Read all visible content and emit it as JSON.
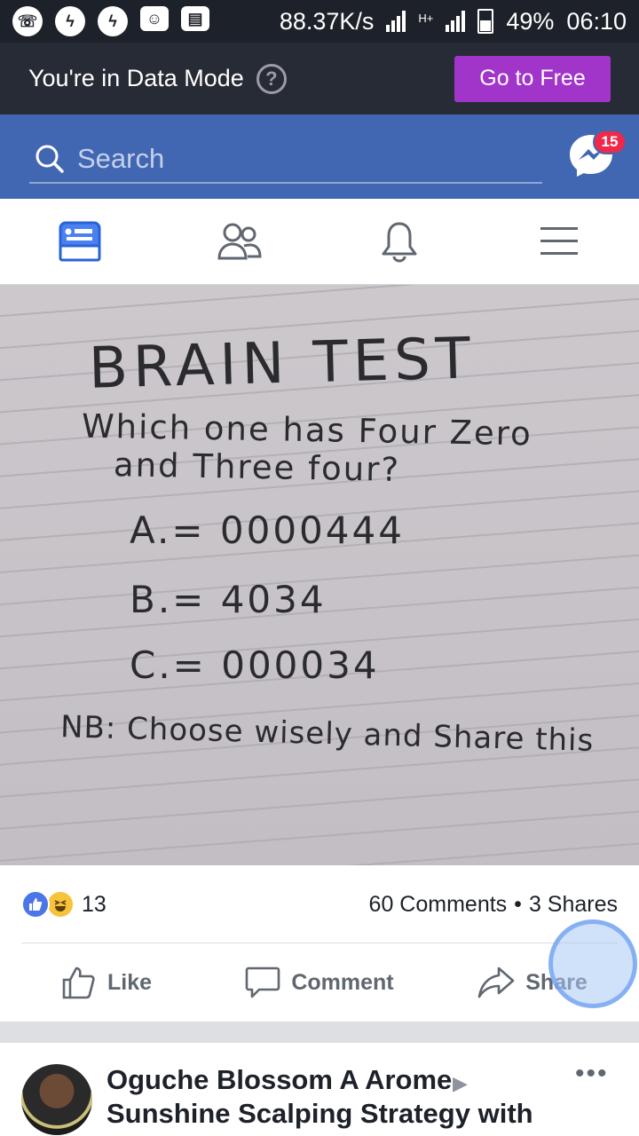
{
  "status_bar": {
    "apps": [
      "whatsapp-icon",
      "messenger-icon",
      "messenger-icon",
      "bbm-icon",
      "video-icon"
    ],
    "network_speed": "88.37K/s",
    "network_type": "H+",
    "battery": "49%",
    "time": "06:10"
  },
  "data_mode": {
    "text": "You're in Data Mode",
    "help": "?",
    "button": "Go to Free"
  },
  "search": {
    "placeholder": "Search",
    "messenger_badge": "15"
  },
  "nav_tabs": [
    "news-feed-icon",
    "friends-icon",
    "notifications-icon",
    "menu-icon"
  ],
  "post": {
    "image": {
      "title": "BRAIN TEST",
      "question_line1": "Which one has Four Zero",
      "question_line2": "and Three four?",
      "option_a": "A.= 0000444",
      "option_b": "B.= 4034",
      "option_c": "C.= 000034",
      "note": "NB: Choose wisely and Share this"
    },
    "reaction_count": "13",
    "comments": "60 Comments",
    "separator": "•",
    "shares": "3 Shares",
    "actions": {
      "like": "Like",
      "comment": "Comment",
      "share": "Share"
    }
  },
  "next_post": {
    "author": "Oguche Blossom A Arome",
    "arrow": "▶",
    "group": "Sunshine Scalping Strategy with",
    "more": "•••"
  },
  "colors": {
    "facebook_blue": "#4267b2",
    "free_button": "#a235c9",
    "badge_red": "#f02849"
  }
}
